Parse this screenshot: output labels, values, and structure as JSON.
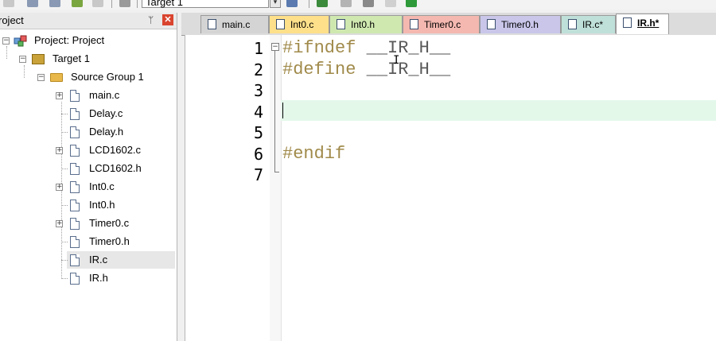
{
  "toolbar": {
    "target_value": "Target 1",
    "combo_arrow": "▾"
  },
  "project_panel": {
    "title": "roject",
    "pin_glyph": "ᛘ",
    "close_glyph": "✕",
    "tree": [
      {
        "label": "Project: Project",
        "type": "project",
        "expanded": true
      },
      {
        "label": "Target 1",
        "type": "target",
        "expanded": true
      },
      {
        "label": "Source Group 1",
        "type": "folder",
        "expanded": true
      },
      {
        "label": "main.c",
        "type": "file",
        "expandable": true
      },
      {
        "label": "Delay.c",
        "type": "file",
        "expandable": false
      },
      {
        "label": "Delay.h",
        "type": "file",
        "expandable": false
      },
      {
        "label": "LCD1602.c",
        "type": "file",
        "expandable": true
      },
      {
        "label": "LCD1602.h",
        "type": "file",
        "expandable": false
      },
      {
        "label": "Int0.c",
        "type": "file",
        "expandable": true
      },
      {
        "label": "Int0.h",
        "type": "file",
        "expandable": false
      },
      {
        "label": "Timer0.c",
        "type": "file",
        "expandable": true
      },
      {
        "label": "Timer0.h",
        "type": "file",
        "expandable": false
      },
      {
        "label": "IR.c",
        "type": "file",
        "expandable": false,
        "selected": true
      },
      {
        "label": "IR.h",
        "type": "file",
        "expandable": false
      }
    ]
  },
  "tabs": [
    {
      "label": "main.c",
      "color": "#d4d4d4"
    },
    {
      "label": "Int0.c",
      "color": "#ffe08a"
    },
    {
      "label": "Int0.h",
      "color": "#cfe8b0"
    },
    {
      "label": "Timer0.c",
      "color": "#f4b8b0"
    },
    {
      "label": "Timer0.h",
      "color": "#c9c6ea"
    },
    {
      "label": "IR.c*",
      "color": "#bfe0d8"
    },
    {
      "label": "IR.h*",
      "color": "#ffffff",
      "active": true
    }
  ],
  "editor": {
    "line_numbers": [
      "1",
      "2",
      "3",
      "4",
      "5",
      "6",
      "7"
    ],
    "lines": [
      "#ifndef __IR_H__",
      "#define __IR_H__",
      "",
      "",
      "",
      "#endif",
      ""
    ],
    "keyword_color": "#a08a4a",
    "text_color": "#5a5a5a",
    "current_line": 4,
    "fold_glyph": "−"
  },
  "cursor": "I"
}
